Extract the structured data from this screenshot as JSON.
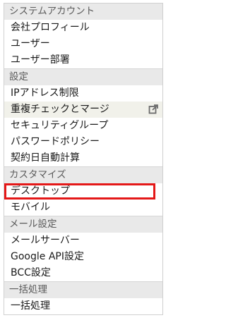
{
  "sections": [
    {
      "header": "システムアカウント",
      "items": [
        "会社プロフィール",
        "ユーザー",
        "ユーザー部署"
      ]
    },
    {
      "header": "設定",
      "items": [
        "IPアドレス制限",
        "重複チェックとマージ",
        "セキュリティグループ",
        "パスワードポリシー",
        "契約日自動計算"
      ]
    },
    {
      "header": "カスタマイズ",
      "items": [
        "デスクトップ",
        "モバイル"
      ]
    },
    {
      "header": "メール設定",
      "items": [
        "メールサーバー",
        "Google API設定",
        "BCC設定"
      ]
    },
    {
      "header": "一括処理",
      "items": [
        "一括処理"
      ]
    }
  ],
  "icons": {
    "external_link": "external-link-icon"
  },
  "colors": {
    "highlight_border": "#e41818",
    "header_bg": "#e9e9e9"
  }
}
